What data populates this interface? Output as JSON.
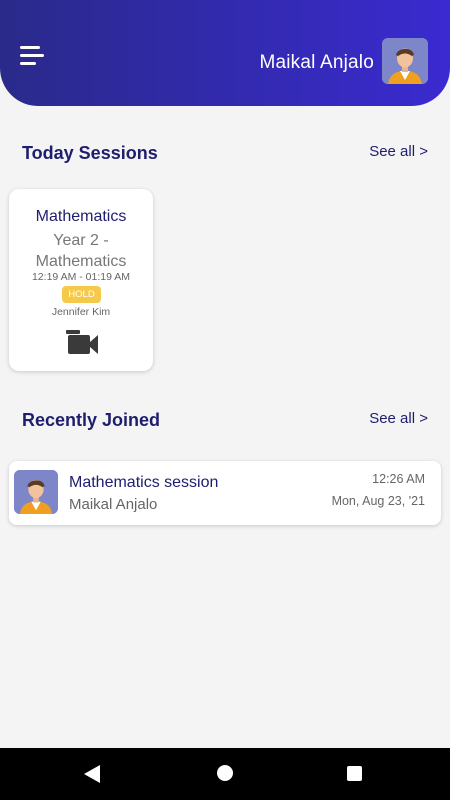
{
  "header": {
    "user_name": "Maikal Anjalo",
    "menu_icon": "menu-icon",
    "avatar_icon": "avatar"
  },
  "today_sessions": {
    "title": "Today Sessions",
    "see_all": "See all >",
    "cards": [
      {
        "subject": "Mathematics",
        "title": "Year 2 - Mathematics",
        "time": "12:19 AM - 01:19 AM",
        "status": "HOLD",
        "teacher": "Jennifer Kim",
        "action_icon": "video-camera-icon"
      }
    ]
  },
  "recently_joined": {
    "title": "Recently Joined",
    "see_all": "See all >",
    "items": [
      {
        "title": "Mathematics session",
        "name": "Maikal Anjalo",
        "time": "12:26 AM",
        "date": "Mon, Aug 23, '21"
      }
    ]
  },
  "colors": {
    "header_start": "#2a2a8a",
    "header_end": "#3a2ad0",
    "title_text": "#1e1e6e",
    "badge_hold": "#f5c94a"
  }
}
